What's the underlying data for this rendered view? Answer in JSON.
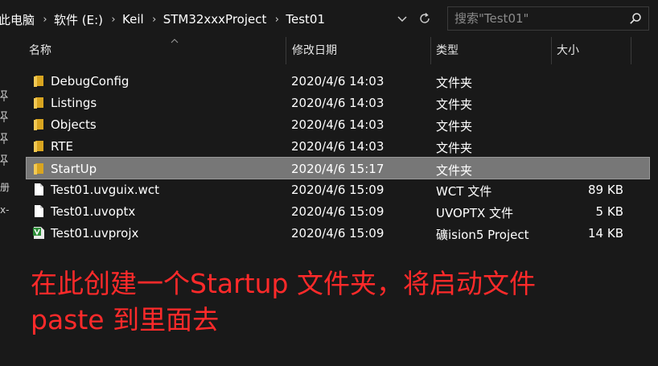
{
  "address": {
    "breadcrumbs": [
      "此电脑",
      "软件 (E:)",
      "Keil",
      "STM32xxxProject",
      "Test01"
    ],
    "separator": "›"
  },
  "search": {
    "placeholder": "搜索\"Test01\""
  },
  "columns": {
    "name": "名称",
    "date": "修改日期",
    "type": "类型",
    "size": "大小"
  },
  "files": [
    {
      "name": "DebugConfig",
      "date": "2020/4/6 14:03",
      "type": "文件夹",
      "size": "",
      "icon": "folder-icon",
      "selected": false
    },
    {
      "name": "Listings",
      "date": "2020/4/6 14:03",
      "type": "文件夹",
      "size": "",
      "icon": "folder-icon",
      "selected": false
    },
    {
      "name": "Objects",
      "date": "2020/4/6 14:03",
      "type": "文件夹",
      "size": "",
      "icon": "folder-icon",
      "selected": false
    },
    {
      "name": "RTE",
      "date": "2020/4/6 14:03",
      "type": "文件夹",
      "size": "",
      "icon": "folder-icon",
      "selected": false
    },
    {
      "name": "StartUp",
      "date": "2020/4/6 15:17",
      "type": "文件夹",
      "size": "",
      "icon": "folder-icon",
      "selected": true
    },
    {
      "name": "Test01.uvguix.wct",
      "date": "2020/4/6 15:09",
      "type": "WCT 文件",
      "size": "89 KB",
      "icon": "document-icon",
      "selected": false
    },
    {
      "name": "Test01.uvoptx",
      "date": "2020/4/6 15:09",
      "type": "UVOPTX 文件",
      "size": "5 KB",
      "icon": "document-icon",
      "selected": false
    },
    {
      "name": "Test01.uvprojx",
      "date": "2020/4/6 15:09",
      "type": "礦ision5 Project",
      "size": "14 KB",
      "icon": "keil-project-icon",
      "selected": false
    }
  ],
  "annotation": {
    "line1": "在此创建一个Startup 文件夹，将启动文件",
    "line2": "paste 到里面去"
  },
  "nav_glyphs": [
    "册",
    "x-"
  ],
  "colors": {
    "background": "#191919",
    "selection": "#777777",
    "folder": "#f0c04a",
    "annotation": "#ff2a2a",
    "keil_icon": "#2f8f3a"
  }
}
